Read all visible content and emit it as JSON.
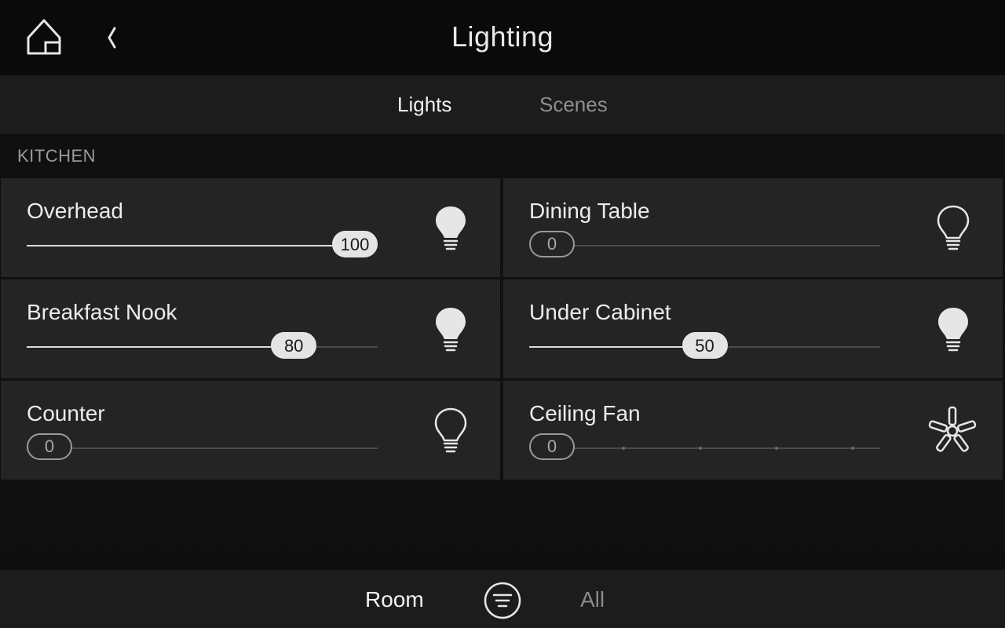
{
  "header": {
    "title": "Lighting"
  },
  "tabs": [
    {
      "label": "Lights",
      "active": true
    },
    {
      "label": "Scenes",
      "active": false
    }
  ],
  "section": {
    "label": "KITCHEN"
  },
  "tiles": [
    {
      "name": "Overhead",
      "level": 100,
      "level_label": "100",
      "state": "on",
      "icon": "bulb-on-icon"
    },
    {
      "name": "Dining Table",
      "level": 0,
      "level_label": "0",
      "state": "off",
      "icon": "bulb-off-icon"
    },
    {
      "name": "Breakfast Nook",
      "level": 80,
      "level_label": "80",
      "state": "on",
      "icon": "bulb-on-icon"
    },
    {
      "name": "Under Cabinet",
      "level": 50,
      "level_label": "50",
      "state": "on",
      "icon": "bulb-on-icon"
    },
    {
      "name": "Counter",
      "level": 0,
      "level_label": "0",
      "state": "off",
      "icon": "bulb-off-icon"
    },
    {
      "name": "Ceiling Fan",
      "level": 0,
      "level_label": "0",
      "state": "off",
      "icon": "fan-icon",
      "steps": 4
    }
  ],
  "bottom_bar": {
    "room_label": "Room",
    "all_label": "All"
  },
  "colors": {
    "background": "#111111",
    "tile": "#242424",
    "active_text": "#f2f2f2",
    "inactive_text": "#8e8e8e",
    "thumb_on": "#e4e4e4"
  }
}
